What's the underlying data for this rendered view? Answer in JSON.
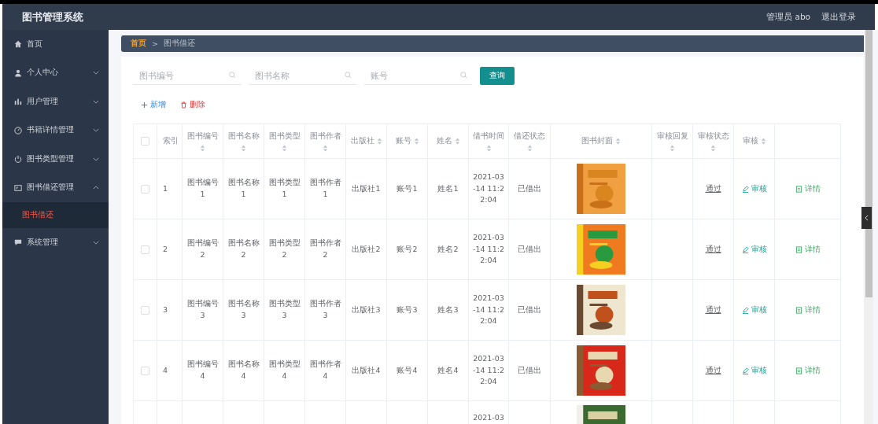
{
  "header": {
    "title": "图书管理系统",
    "user": "管理员 abo",
    "logout": "退出登录"
  },
  "sidebar": {
    "items": [
      {
        "label": "首页",
        "expandable": false
      },
      {
        "label": "个人中心",
        "expandable": true,
        "expanded": false
      },
      {
        "label": "用户管理",
        "expandable": true,
        "expanded": false
      },
      {
        "label": "书籍详情管理",
        "expandable": true,
        "expanded": false
      },
      {
        "label": "图书类型管理",
        "expandable": true,
        "expanded": false
      },
      {
        "label": "图书借还管理",
        "expandable": true,
        "expanded": true,
        "children": [
          {
            "label": "图书借还",
            "selected": true
          }
        ]
      },
      {
        "label": "系统管理",
        "expandable": true,
        "expanded": false
      }
    ]
  },
  "breadcrumb": {
    "items": [
      "首页",
      "图书借还"
    ],
    "separator": ">"
  },
  "search": {
    "fields": [
      {
        "placeholder": "图书编号"
      },
      {
        "placeholder": "图书名称"
      },
      {
        "placeholder": "账号"
      }
    ],
    "button": "查询"
  },
  "actions": [
    {
      "kind": "add",
      "label": "新增"
    },
    {
      "kind": "delete",
      "label": "删除"
    }
  ],
  "table": {
    "select_all_checked": false,
    "columns": [
      {
        "label": "索引",
        "sortable": false
      },
      {
        "label": "图书编号",
        "sortable": true
      },
      {
        "label": "图书名称",
        "sortable": true
      },
      {
        "label": "图书类型",
        "sortable": true
      },
      {
        "label": "图书作者",
        "sortable": true
      },
      {
        "label": "出版社",
        "sortable": true
      },
      {
        "label": "账号",
        "sortable": true
      },
      {
        "label": "姓名",
        "sortable": true
      },
      {
        "label": "借书时间",
        "sortable": true
      },
      {
        "label": "借还状态",
        "sortable": true
      },
      {
        "label": "图书封面",
        "sortable": true
      },
      {
        "label": "审核回复",
        "sortable": true
      },
      {
        "label": "审核状态",
        "sortable": true
      },
      {
        "label": "审核",
        "sortable": true
      }
    ],
    "rows": [
      {
        "checked": false,
        "cells": [
          "1",
          "图书编号1",
          "图书名称1",
          "图书类型1",
          "图书作者1",
          "出版社1",
          "账号1",
          "姓名1",
          "2021-03-14 11:22:04",
          "已借出",
          "",
          "",
          "通过"
        ],
        "cover": {
          "kind": "picture"
        },
        "review": "审核",
        "detail": "详情"
      },
      {
        "checked": false,
        "cells": [
          "2",
          "图书编号2",
          "图书名称2",
          "图书类型2",
          "图书作者2",
          "出版社2",
          "账号2",
          "姓名2",
          "2021-03-14 11:22:04",
          "已借出",
          "",
          "",
          "通过"
        ],
        "cover": {
          "kind": "picture"
        },
        "review": "审核",
        "detail": "详情"
      },
      {
        "checked": false,
        "cells": [
          "3",
          "图书编号3",
          "图书名称3",
          "图书类型3",
          "图书作者3",
          "出版社3",
          "账号3",
          "姓名3",
          "2021-03-14 11:22:04",
          "已借出",
          "",
          "",
          "通过"
        ],
        "cover": {
          "kind": "picture"
        },
        "review": "审核",
        "detail": "详情"
      },
      {
        "checked": false,
        "cells": [
          "4",
          "图书编号4",
          "图书名称4",
          "图书类型4",
          "图书作者4",
          "出版社4",
          "账号4",
          "姓名4",
          "2021-03-14 11:22:04",
          "已借出",
          "",
          "",
          "通过"
        ],
        "cover": {
          "kind": "picture"
        },
        "review": "审核",
        "detail": "详情"
      },
      {
        "cells": [
          "",
          "",
          "",
          "",
          "",
          "",
          "",
          "",
          "2021-03"
        ],
        "cover": {
          "kind": "picture"
        }
      }
    ]
  }
}
